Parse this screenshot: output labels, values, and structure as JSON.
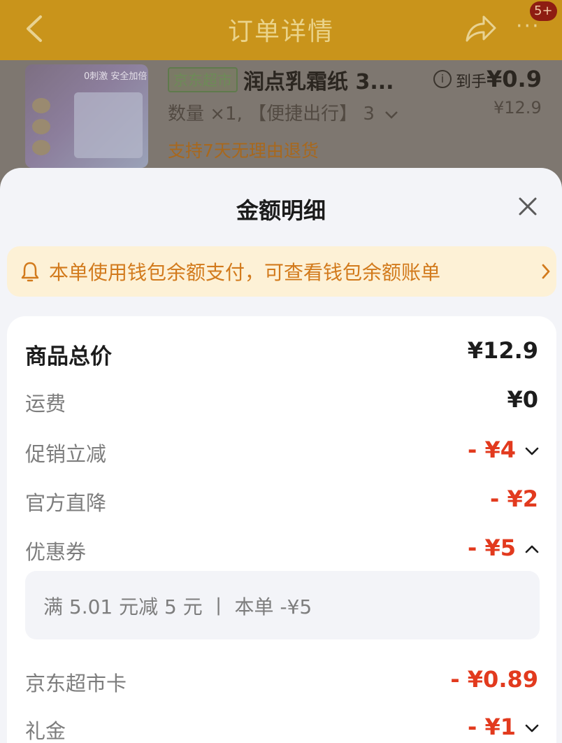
{
  "background": {
    "header_title": "订单详情",
    "badge": "5+",
    "product": {
      "thumb_text": "0刺激 安全加倍",
      "store_tag": "京东超市",
      "name": "润点乳霜纸 3...",
      "final_prefix": "到手",
      "final_price": "¥0.9",
      "qty_text": "数量 ×1, 【便捷出行】 3",
      "orig_price": "¥12.9",
      "policy": "支持7天无理由退货"
    }
  },
  "sheet": {
    "title": "金额明细",
    "notice": "本单使用钱包余额支付，可查看钱包余额账单",
    "rows": [
      {
        "label": "商品总价",
        "amount": "¥12.9"
      },
      {
        "label": "运费",
        "amount": "¥0"
      },
      {
        "label": "促销立减",
        "amount": "- ¥4"
      },
      {
        "label": "官方直降",
        "amount": "- ¥2"
      },
      {
        "label": "优惠券",
        "amount": "- ¥5"
      },
      {
        "label": "京东超市卡",
        "amount": "- ¥0.89"
      },
      {
        "label": "礼金",
        "amount": "- ¥1"
      }
    ],
    "coupon_detail": "满 5.01 元减 5 元  丨 本单 -¥5"
  },
  "colors": {
    "accent_red": "#e23a1e",
    "notice_text": "#d27a1c",
    "notice_bg": "#fdf1d6"
  },
  "icons": [
    "back-arrow-icon",
    "share-icon",
    "more-icon",
    "info-icon",
    "chevron-down-icon",
    "close-icon",
    "bell-icon",
    "chevron-right-icon",
    "chevron-up-icon"
  ]
}
